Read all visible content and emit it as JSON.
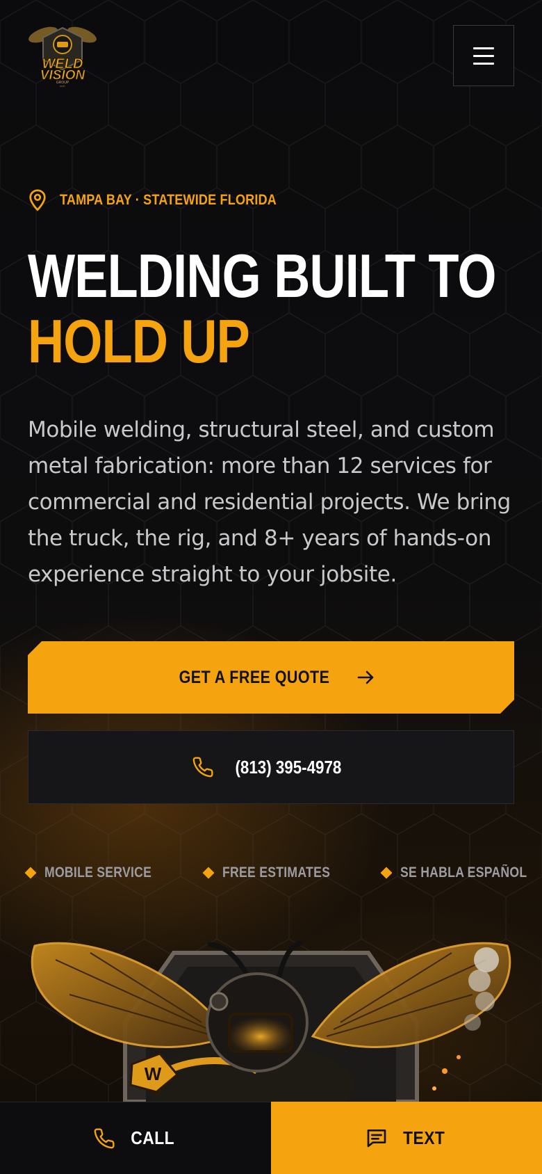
{
  "brand": {
    "logo_text_1": "WELD",
    "logo_text_2": "VISION",
    "logo_text_3": "GROUP",
    "logo_text_4": "LLC",
    "accent_color": "#f5a30f"
  },
  "header": {
    "menu_icon": "hamburger-icon"
  },
  "hero": {
    "location": "TAMPA BAY · STATEWIDE FLORIDA",
    "title_line1": "WELDING BUILT TO",
    "title_line2": "HOLD UP",
    "description": "Mobile welding, structural steel, and custom metal fabrication: more than 12 services for commercial and residential projects. We bring the truck, the rig, and 8+ years of hands-on experience straight to your jobsite.",
    "quote_button": "GET A FREE QUOTE",
    "phone_button": "(813) 395-4978"
  },
  "badges": [
    "MOBILE SERVICE",
    "FREE ESTIMATES",
    "SE HABLA ESPAÑOL"
  ],
  "bottom_bar": {
    "call_label": "CALL",
    "text_label": "TEXT"
  }
}
